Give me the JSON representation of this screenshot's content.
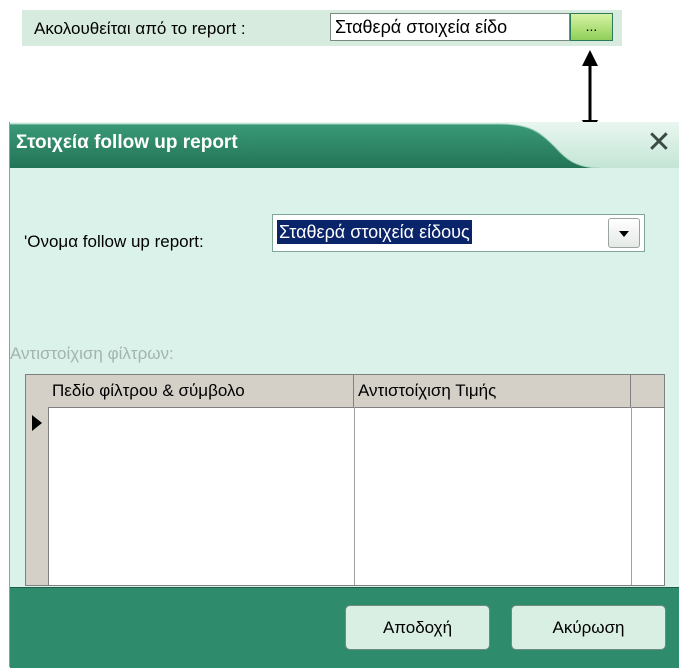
{
  "top": {
    "label": "Ακολουθείται από το report :",
    "field_value": "Σταθερά στοιχεία είδο",
    "browse_label": "..."
  },
  "dialog": {
    "title": "Στοιχεία follow up report",
    "close_label": "✕",
    "name_label": "'Ονομα follow up report:",
    "name_value": "Σταθερά στοιχεία είδους",
    "filters_label": "Αντιστοίχιση φίλτρων:",
    "grid": {
      "columns": [
        "Πεδίο φίλτρου & σύμβολο",
        "Αντιστοίχιση Τιμής",
        ""
      ],
      "rows": []
    },
    "ok_label": "Αποδοχή",
    "cancel_label": "Ακύρωση"
  },
  "colors": {
    "title_bar": "#2e8b6b",
    "dialog_bg": "#dbf2ea",
    "bottom_bar": "#2e8b6b",
    "selection": "#0a246a"
  }
}
